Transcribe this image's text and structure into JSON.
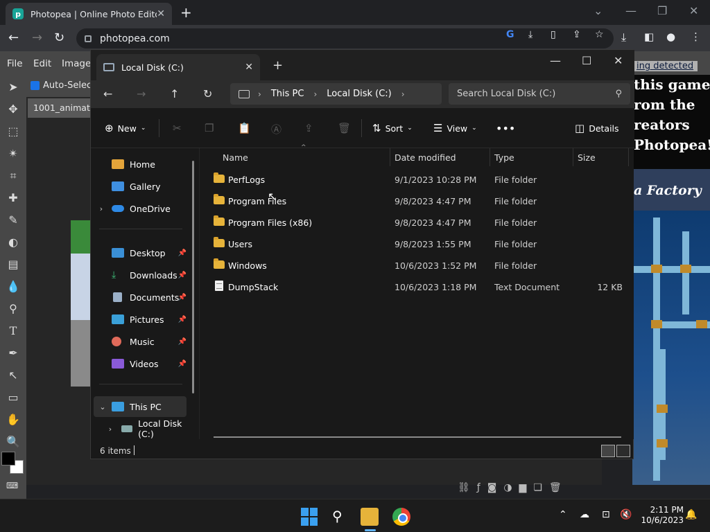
{
  "chrome": {
    "tab_title": "Photopea | Online Photo Editor",
    "url": "photopea.com"
  },
  "photopea": {
    "menus": [
      "File",
      "Edit",
      "Image"
    ],
    "auto_select_label": "Auto-Select",
    "doc_tab": "1001_animat",
    "ad_link": "ing detected",
    "ad_lines": [
      "this game",
      "rom the",
      "reators",
      "Photopea!"
    ],
    "ad_brand": "a Factory"
  },
  "explorer": {
    "tab_title": "Local Disk (C:)",
    "breadcrumb": [
      "This PC",
      "Local Disk (C:)"
    ],
    "search_placeholder": "Search Local Disk (C:)",
    "commands": {
      "new": "New",
      "sort": "Sort",
      "view": "View",
      "details": "Details"
    },
    "nav": {
      "home": "Home",
      "gallery": "Gallery",
      "onedrive": "OneDrive",
      "desktop": "Desktop",
      "downloads": "Downloads",
      "documents": "Documents",
      "pictures": "Pictures",
      "music": "Music",
      "videos": "Videos",
      "this_pc": "This PC",
      "local_disk": "Local Disk (C:)"
    },
    "columns": {
      "name": "Name",
      "date": "Date modified",
      "type": "Type",
      "size": "Size"
    },
    "files": [
      {
        "name": "PerfLogs",
        "date": "9/1/2023 10:28 PM",
        "type": "File folder",
        "size": ""
      },
      {
        "name": "Program Files",
        "date": "9/8/2023 4:47 PM",
        "type": "File folder",
        "size": ""
      },
      {
        "name": "Program Files (x86)",
        "date": "9/8/2023 4:47 PM",
        "type": "File folder",
        "size": ""
      },
      {
        "name": "Users",
        "date": "9/8/2023 1:55 PM",
        "type": "File folder",
        "size": ""
      },
      {
        "name": "Windows",
        "date": "10/6/2023 1:52 PM",
        "type": "File folder",
        "size": ""
      },
      {
        "name": "DumpStack",
        "date": "10/6/2023 1:18 PM",
        "type": "Text Document",
        "size": "12 KB"
      }
    ],
    "status": "6 items"
  },
  "taskbar": {
    "time": "2:11 PM",
    "date": "10/6/2023"
  },
  "colors": {
    "folder": "#e6b33a",
    "accent": "#3aa0f0"
  }
}
